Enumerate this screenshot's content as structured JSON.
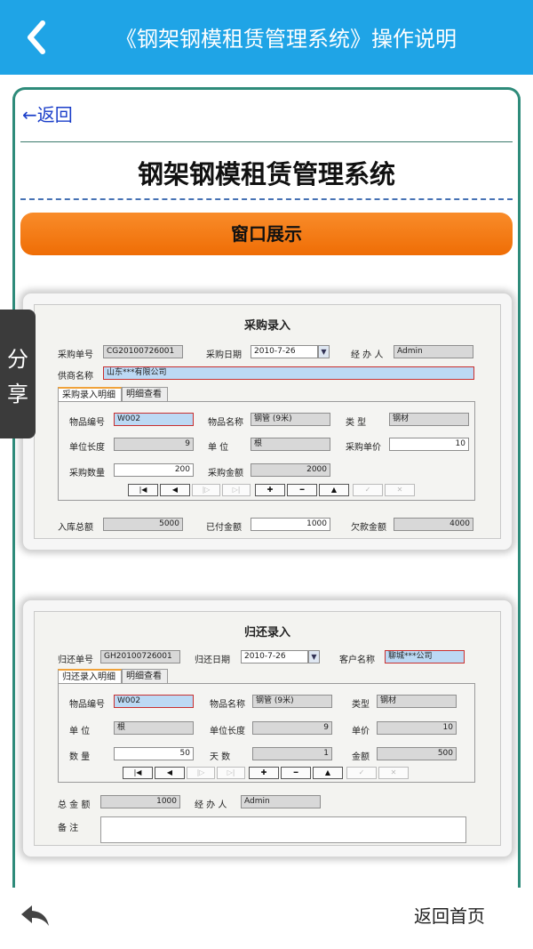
{
  "header": {
    "title": "《钢架钢模租赁管理系统》操作说明"
  },
  "content": {
    "back_link": "←返回",
    "doc_title": "钢架钢模租赁管理系统",
    "section_banner": "窗口展示"
  },
  "purchase_window": {
    "title": "采购录入",
    "order_no_label": "采购单号",
    "order_no": "CG20100726001",
    "date_label": "采购日期",
    "date": "2010-7-26",
    "handler_label": "经 办 人",
    "handler": "Admin",
    "supplier_label": "供商名称",
    "supplier": "山东***有限公司",
    "tab_detail_entry": "采购录入明细",
    "tab_detail_view": "明细查看",
    "item_no_label": "物品编号",
    "item_no": "W002",
    "item_name_label": "物品名称",
    "item_name": "钢管 (9米)",
    "type_label": "类  型",
    "type": "钢材",
    "unit_length_label": "单位长度",
    "unit_length": "9",
    "unit_label": "单  位",
    "unit": "根",
    "unit_price_label": "采购单价",
    "unit_price": "10",
    "qty_label": "采购数量",
    "qty": "200",
    "amount_label": "采购金额",
    "amount": "2000",
    "stock_total_label": "入库总额",
    "stock_total": "5000",
    "paid_label": "已付金额",
    "paid": "1000",
    "owed_label": "欠款金额",
    "owed": "4000"
  },
  "return_window": {
    "title": "归还录入",
    "order_no_label": "归还单号",
    "order_no": "GH20100726001",
    "date_label": "归还日期",
    "date": "2010-7-26",
    "customer_label": "客户名称",
    "customer": "聊城***公司",
    "tab_detail_entry": "归还录入明细",
    "tab_detail_view": "明细查看",
    "item_no_label": "物品编号",
    "item_no": "W002",
    "item_name_label": "物品名称",
    "item_name": "钢管 (9米)",
    "type_label": "类型",
    "type": "钢材",
    "unit_label": "单  位",
    "unit": "根",
    "unit_length_label": "单位长度",
    "unit_length": "9",
    "unit_price_label": "单价",
    "unit_price": "10",
    "qty_label": "数  量",
    "qty": "50",
    "days_label": "天  数",
    "days": "1",
    "amount_label": "金额",
    "amount": "500",
    "total_label": "总 金 额",
    "total": "1000",
    "handler_label": "经 办 人",
    "handler": "Admin",
    "memo_label": "备  注"
  },
  "nav_buttons": {
    "first": "|◀",
    "prev": "◀",
    "next": "|▷",
    "last": "▷|",
    "add": "✚",
    "remove": "━",
    "up": "▲",
    "confirm": "✓",
    "cancel": "✕"
  },
  "share": {
    "char1": "分",
    "char2": "享"
  },
  "bottom": {
    "home_label": "返回首页"
  },
  "colors": {
    "appbar": "#1fa4e6",
    "frame_border": "#2e8b7a",
    "banner": "#f57e17",
    "link": "#1a3ec9"
  }
}
